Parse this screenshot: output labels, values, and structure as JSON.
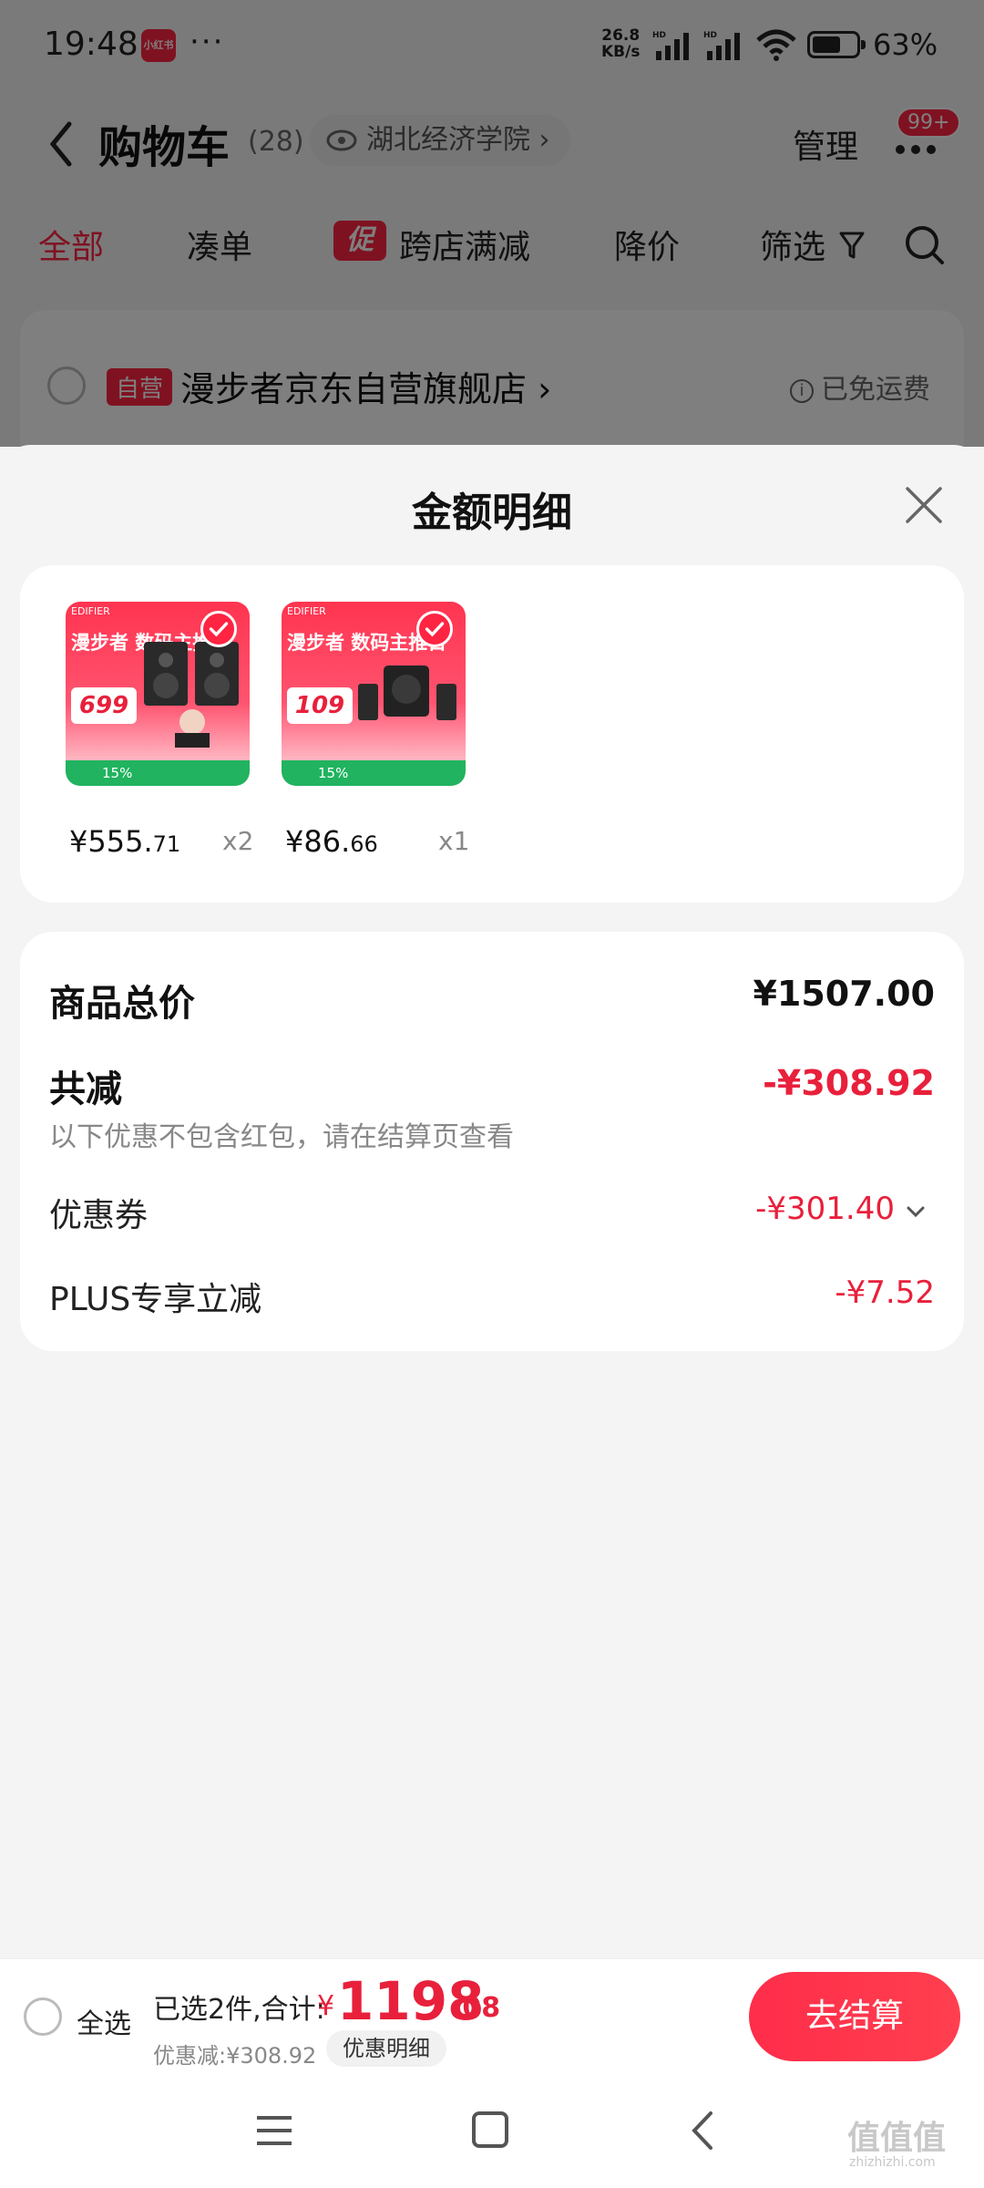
{
  "status_bar": {
    "time": "19:48",
    "app_badge": "小红书",
    "more_dots": "···",
    "net_speed_value": "26.8",
    "net_speed_unit": "KB/s",
    "battery_percent": "63%",
    "battery_level": 0.63
  },
  "nav": {
    "title": "购物车",
    "count": "(28)",
    "location": "湖北经济学院 ›",
    "manage": "管理",
    "badge": "99+"
  },
  "tabs": [
    "全部",
    "凑单",
    "跨店满减",
    "降价",
    "筛选"
  ],
  "promo_tag": "促",
  "store": {
    "tag": "自营",
    "name": "漫步者京东自营旗舰店 ›",
    "shipping": "已免运费"
  },
  "sheet": {
    "title": "金额明细",
    "products": [
      {
        "headline": "漫步者 数码主推日",
        "promo_price": "699",
        "discount": "15%",
        "price_int": "¥555.",
        "price_dec": "71",
        "qty": "x2"
      },
      {
        "headline": "漫步者 数码主推日",
        "promo_price": "109",
        "discount": "15%",
        "price_int": "¥86.",
        "price_dec": "66",
        "qty": "x1"
      }
    ],
    "summary": {
      "total_label": "商品总价",
      "total_value": "¥1507.00",
      "reduce_label": "共减",
      "reduce_value": "-¥308.92",
      "reduce_note": "以下优惠不包含红包，请在结算页查看",
      "coupon_label": "优惠券",
      "coupon_value": "-¥301.40",
      "plus_label": "PLUS专享立减",
      "plus_value": "-¥7.52"
    }
  },
  "checkout": {
    "select_all": "全选",
    "selected_text": "已选2件,合计:",
    "currency": "¥",
    "total_int": "1198",
    "total_dec": ".08",
    "discount_text": "优惠减:¥308.92",
    "detail_button": "优惠明细",
    "checkout_button": "去结算"
  },
  "watermark": {
    "text": "值值值",
    "sub": "zhizhizhi.com"
  },
  "colors": {
    "accent": "#ff2442",
    "price_red": "#e8203b",
    "promo_green": "#21b35f"
  }
}
